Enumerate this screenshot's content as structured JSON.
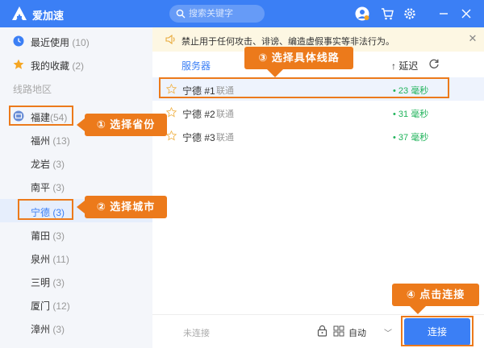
{
  "app": {
    "title": "爱加速"
  },
  "search": {
    "placeholder": "搜索关键字"
  },
  "sidebar": {
    "recent": {
      "label": "最近使用",
      "count": "(10)"
    },
    "favorites": {
      "label": "我的收藏",
      "count": "(2)"
    },
    "section_label": "线路地区",
    "province": {
      "label": "福建",
      "count": "(54)"
    },
    "cities": [
      {
        "label": "福州",
        "count": "(13)"
      },
      {
        "label": "龙岩",
        "count": "(3)"
      },
      {
        "label": "南平",
        "count": "(3)"
      },
      {
        "label": "宁德",
        "count": "(3)"
      },
      {
        "label": "莆田",
        "count": "(3)"
      },
      {
        "label": "泉州",
        "count": "(11)"
      },
      {
        "label": "三明",
        "count": "(3)"
      },
      {
        "label": "厦门",
        "count": "(12)"
      },
      {
        "label": "漳州",
        "count": "(3)"
      }
    ]
  },
  "notice": {
    "text": "禁止用于任何攻击、诽谤、编造虚假事实等非法行为。"
  },
  "table": {
    "col_server": "服务器",
    "col_latency": "↑ 延迟",
    "rows": [
      {
        "name": "宁德 #1",
        "isp": "联通",
        "latency": "• 23 毫秒"
      },
      {
        "name": "宁德 #2",
        "isp": "联通",
        "latency": "• 31 毫秒"
      },
      {
        "name": "宁德 #3",
        "isp": "联通",
        "latency": "• 37 毫秒"
      }
    ]
  },
  "footer": {
    "status": "未连接",
    "mode": "自动",
    "connect_label": "连接"
  },
  "annotations": {
    "step1": "① 选择省份",
    "step2": "② 选择城市",
    "step3": "③ 选择具体线路",
    "step4": "④ 点击连接"
  },
  "colors": {
    "brand": "#3b7ff5",
    "annotation": "#ec7a1b",
    "latency_good": "#1fb35a",
    "notice_bg": "#fdf7e3"
  }
}
